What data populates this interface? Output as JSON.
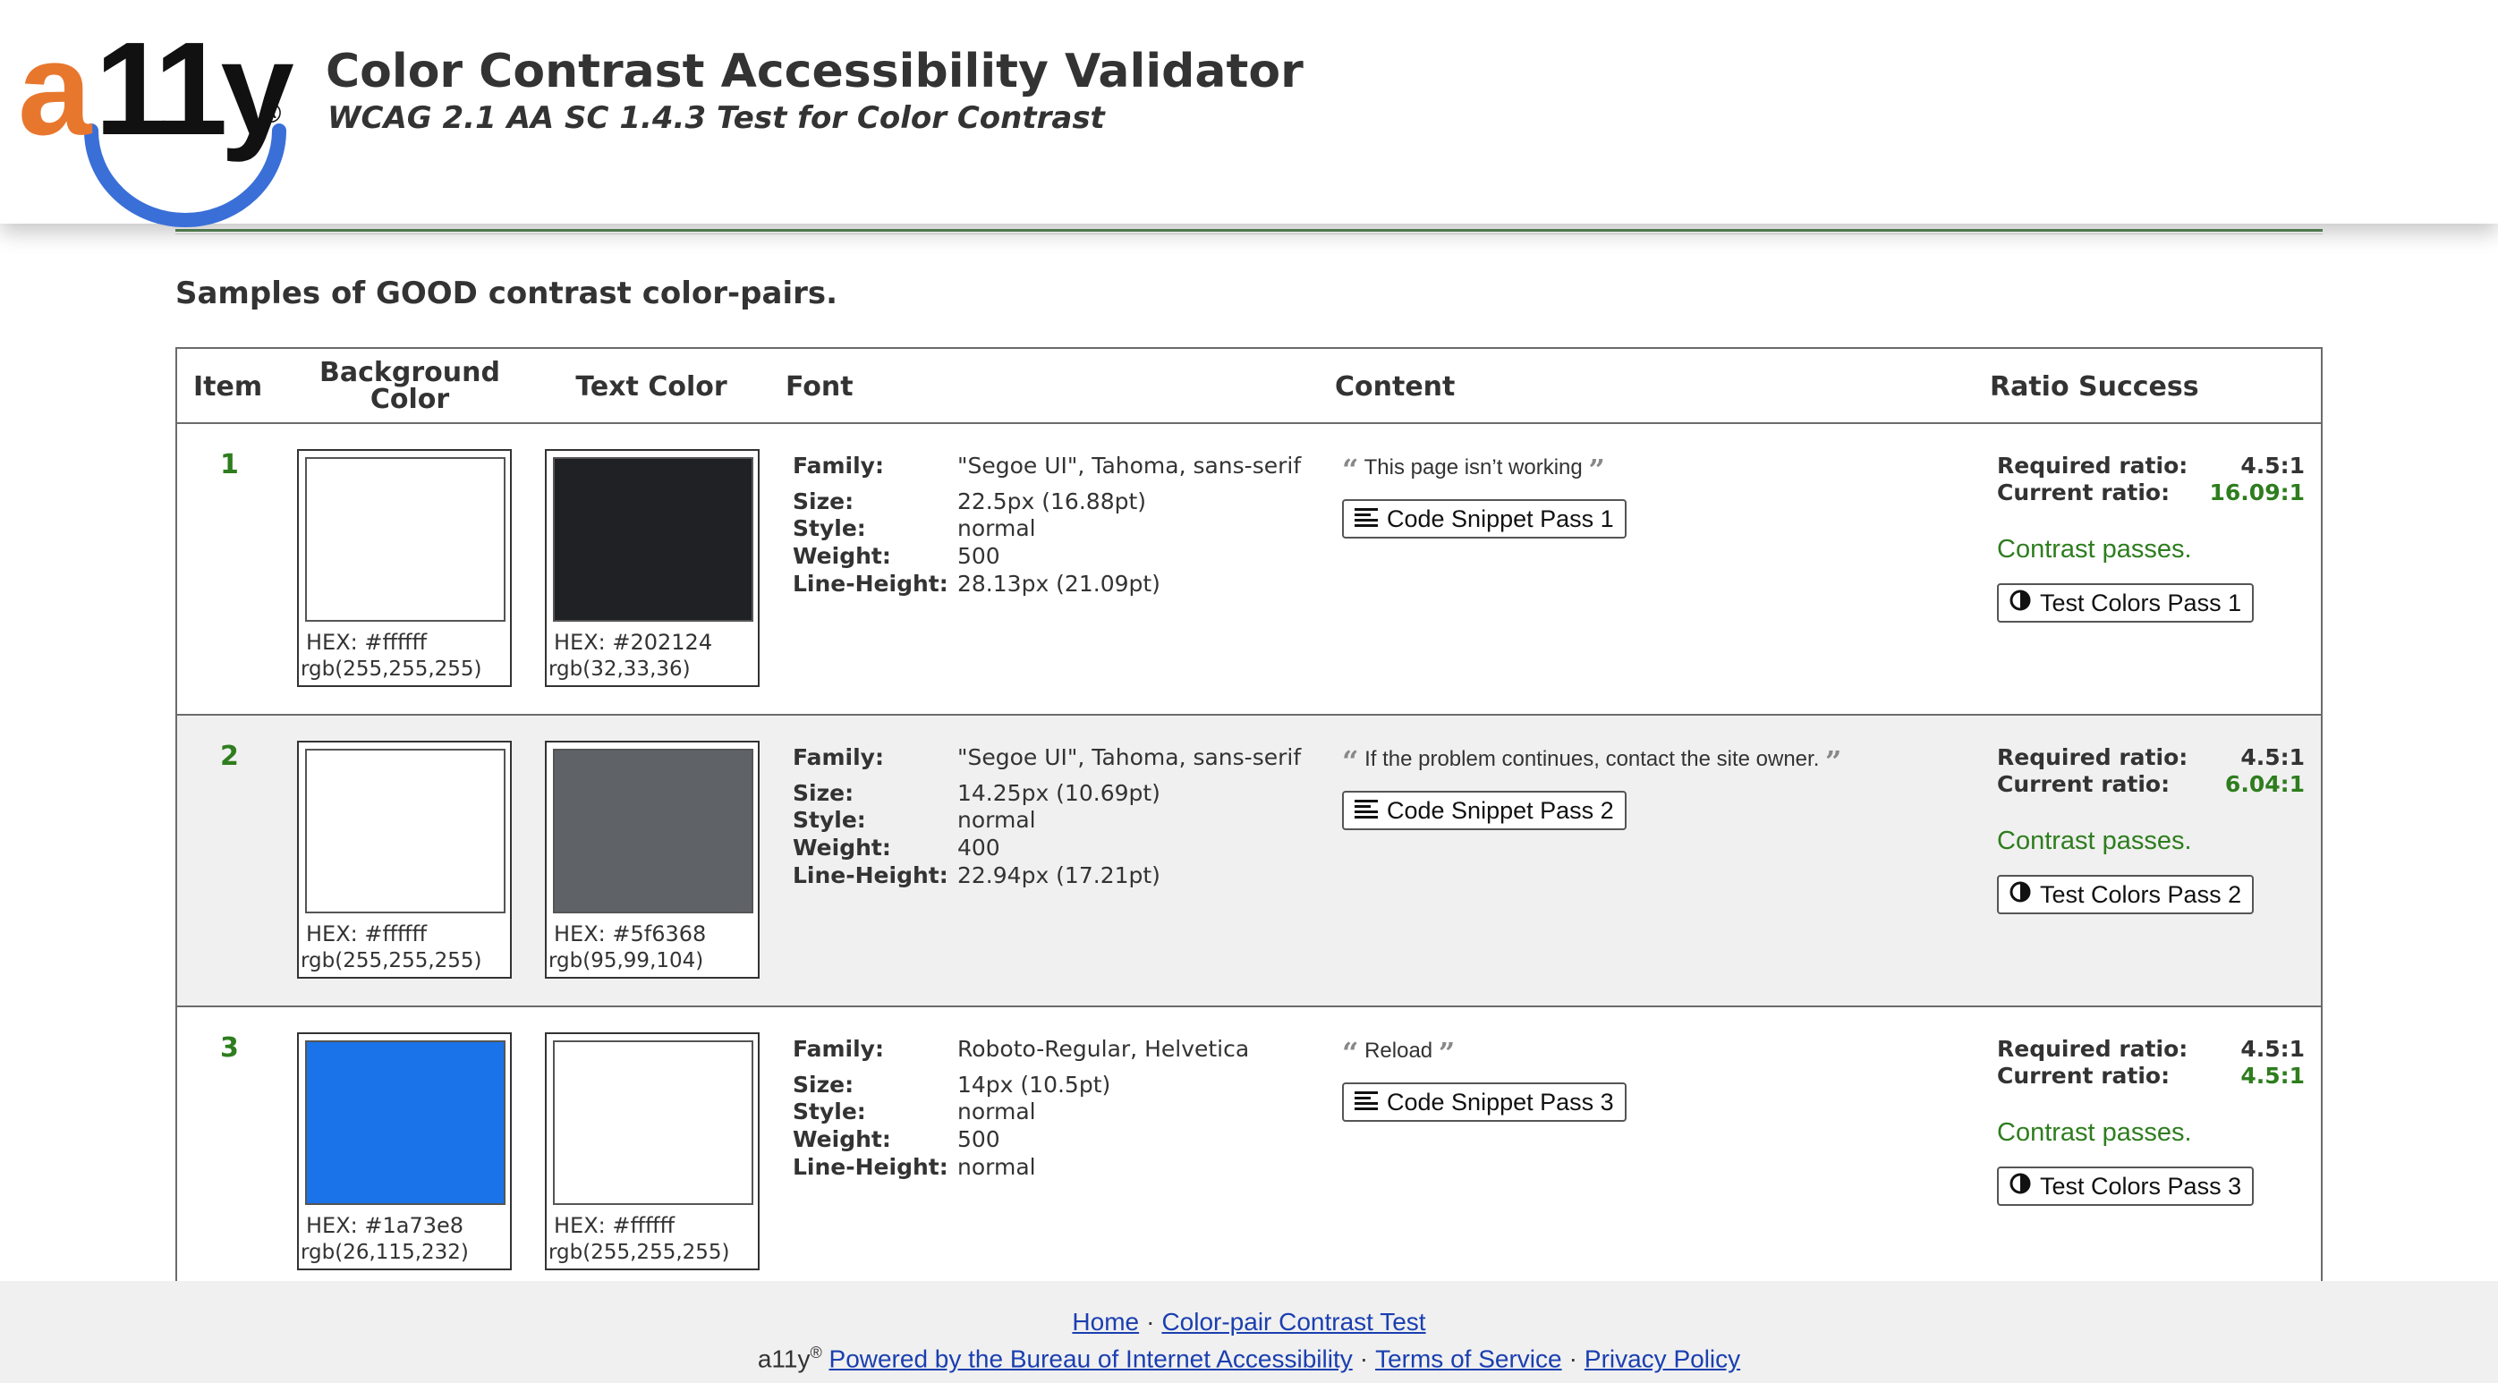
{
  "header": {
    "logo_text_a": "a",
    "logo_text_rest": "11y",
    "logo_reg": "®",
    "title": "Color Contrast Accessibility Validator",
    "subtitle": "WCAG 2.1 AA SC 1.4.3 Test for Color Contrast"
  },
  "section_title": "Samples of GOOD contrast color-pairs.",
  "table": {
    "columns": {
      "item": "Item",
      "background_line1": "Background",
      "background_line2": "Color",
      "text_color": "Text Color",
      "font": "Font",
      "content": "Content",
      "ratio": "Ratio Success"
    },
    "font_keys": {
      "family": "Family:",
      "size": "Size:",
      "style": "Style:",
      "weight": "Weight:",
      "line_height": "Line-Height:"
    },
    "ratio_labels": {
      "required": "Required ratio:",
      "current": "Current ratio:"
    },
    "rows": [
      {
        "item": "1",
        "bg_hex": "HEX: #ffffff",
        "bg_rgb": "rgb(255,255,255)",
        "bg_color": "#ffffff",
        "fg_hex": "HEX: #202124",
        "fg_rgb": "rgb(32,33,36)",
        "fg_color": "#202124",
        "family": "\"Segoe UI\", Tahoma, sans-serif",
        "size": "22.5px (16.88pt)",
        "style": "normal",
        "weight": "500",
        "line_height": "28.13px (21.09pt)",
        "content": "This page isn’t working",
        "snippet_label": "Code Snippet Pass 1",
        "required": "4.5:1",
        "current": "16.09:1",
        "result": "Contrast passes.",
        "test_label": "Test Colors Pass 1"
      },
      {
        "item": "2",
        "bg_hex": "HEX: #ffffff",
        "bg_rgb": "rgb(255,255,255)",
        "bg_color": "#ffffff",
        "fg_hex": "HEX: #5f6368",
        "fg_rgb": "rgb(95,99,104)",
        "fg_color": "#5f6368",
        "family": "\"Segoe UI\", Tahoma, sans-serif",
        "size": "14.25px (10.69pt)",
        "style": "normal",
        "weight": "400",
        "line_height": "22.94px (17.21pt)",
        "content": "If the problem continues, contact the site owner.",
        "snippet_label": "Code Snippet Pass 2",
        "required": "4.5:1",
        "current": "6.04:1",
        "result": "Contrast passes.",
        "test_label": "Test Colors Pass 2"
      },
      {
        "item": "3",
        "bg_hex": "HEX: #1a73e8",
        "bg_rgb": "rgb(26,115,232)",
        "bg_color": "#1a73e8",
        "fg_hex": "HEX: #ffffff",
        "fg_rgb": "rgb(255,255,255)",
        "fg_color": "#ffffff",
        "family": "Roboto-Regular, Helvetica",
        "size": "14px (10.5pt)",
        "style": "normal",
        "weight": "500",
        "line_height": "normal",
        "content": "Reload",
        "snippet_label": "Code Snippet Pass 3",
        "required": "4.5:1",
        "current": "4.5:1",
        "result": "Contrast passes.",
        "test_label": "Test Colors Pass 3"
      }
    ]
  },
  "footer": {
    "home": "Home",
    "contrast_test": "Color-pair Contrast Test",
    "brand": "a11y",
    "brand_reg": "®",
    "powered": "Powered by the Bureau of Internet Accessibility",
    "terms": "Terms of Service",
    "privacy": "Privacy Policy",
    "separator": "·"
  },
  "colors": {
    "accent_orange": "#e8772e",
    "logo_blue": "#3a6fd8",
    "pass_green": "#2e7d1e",
    "link_blue": "#1a3fb0"
  },
  "icons": {
    "snippet": "align-left-icon",
    "test": "contrast-icon",
    "quote_open": "quote-open-icon",
    "quote_close": "quote-close-icon"
  }
}
